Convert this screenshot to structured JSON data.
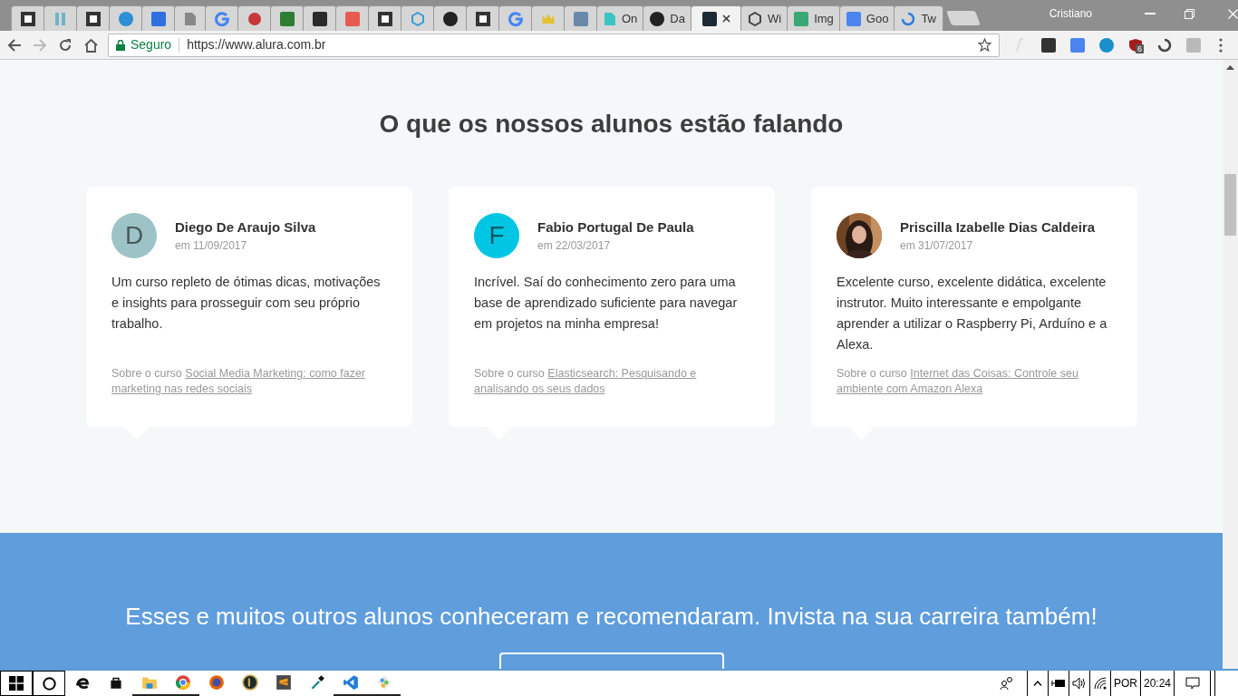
{
  "browser": {
    "tabs": [
      {
        "kind": "mono",
        "color": "#333333",
        "selected": false
      },
      {
        "kind": "letters",
        "color": "#6fb3c8",
        "selected": false
      },
      {
        "kind": "mono",
        "color": "#333333",
        "selected": false
      },
      {
        "kind": "circle",
        "color": "#2d8fd5",
        "selected": false
      },
      {
        "kind": "square",
        "color": "#2f6fe0",
        "selected": false
      },
      {
        "kind": "page",
        "color": "#888888",
        "selected": false
      },
      {
        "kind": "multi",
        "color": "#4285f4",
        "selected": false
      },
      {
        "kind": "dot",
        "color": "#c8383a",
        "selected": false
      },
      {
        "kind": "square",
        "color": "#2e7d32",
        "selected": false
      },
      {
        "kind": "square",
        "color": "#2b2b2b",
        "selected": false
      },
      {
        "kind": "square",
        "color": "#e85a4f",
        "selected": false
      },
      {
        "kind": "mono",
        "color": "#333333",
        "selected": false
      },
      {
        "kind": "hexagon",
        "color": "#3a9ad9",
        "selected": false
      },
      {
        "kind": "circle",
        "color": "#222222",
        "selected": false
      },
      {
        "kind": "mono",
        "color": "#333333",
        "selected": false
      },
      {
        "kind": "multi",
        "color": "#4285f4",
        "selected": false
      },
      {
        "kind": "crown",
        "color": "#e2c230",
        "selected": false
      },
      {
        "kind": "square",
        "color": "#6a88a8",
        "selected": false
      },
      {
        "kind": "page",
        "color": "#3cc4c4",
        "title": "On",
        "selected": false
      },
      {
        "kind": "circle",
        "color": "#222222",
        "title": "Da",
        "selected": false
      },
      {
        "kind": "square",
        "color": "#1c2b33",
        "selected": true
      },
      {
        "kind": "hexagon",
        "color": "#444444",
        "title": "Wi",
        "selected": false
      },
      {
        "kind": "square",
        "color": "#3aa876",
        "title": "Img",
        "selected": false
      },
      {
        "kind": "square",
        "color": "#4a85f0",
        "title": "Goo",
        "selected": false
      },
      {
        "kind": "ring",
        "color": "#2f7de1",
        "title": "Tw",
        "selected": false
      }
    ],
    "user": "Cristiano",
    "security": "Seguro",
    "url": "https://www.alura.com.br",
    "extensions": [
      {
        "kind": "faded",
        "color": "#dddddd"
      },
      {
        "kind": "square",
        "color": "#333333"
      },
      {
        "kind": "square",
        "color": "#4a85f0"
      },
      {
        "kind": "circle",
        "color": "#1a8fc9"
      },
      {
        "kind": "shield",
        "color": "#a51d1d",
        "badge": "6"
      },
      {
        "kind": "ring",
        "color": "#444444"
      },
      {
        "kind": "square",
        "color": "#b9b9b9"
      }
    ]
  },
  "page": {
    "heading": "O que os nossos alunos estão falando",
    "testimonials": [
      {
        "avatar": {
          "kind": "letter",
          "letter": "D",
          "color": "#9dc3c6"
        },
        "name": "Diego De Araujo Silva",
        "date": "em 11/09/2017",
        "text": "Um curso repleto de ótimas dicas, motivações e insights para prosseguir com seu próprio trabalho.",
        "course_prefix": "Sobre o curso",
        "course": "Social Media Marketing: como fazer marketing nas redes sociais"
      },
      {
        "avatar": {
          "kind": "letter",
          "letter": "F",
          "color": "#00c6e3"
        },
        "name": "Fabio Portugal De Paula",
        "date": "em 22/03/2017",
        "text": "Incrível. Saí do conhecimento zero para uma base de aprendizado suficiente para navegar em projetos na minha empresa!",
        "course_prefix": "Sobre o curso",
        "course": "Elasticsearch: Pesquisando e analisando os seus dados"
      },
      {
        "name": "Priscilla Izabelle Dias Caldeira",
        "date": "em 31/07/2017",
        "text": "Excelente curso, excelente didática, excelente instrutor. Muito interessante e empolgante aprender a utilizar o Raspberry Pi, Arduíno e a Alexa.",
        "course_prefix": "Sobre o curso",
        "course": "Internet das Coisas: Controle seu ambiente com Amazon Alexa"
      }
    ],
    "cta_text": "Esses e muitos outros alunos conheceram e recomendaram. Invista na sua carreira também!"
  },
  "taskbar": {
    "apps": [
      {
        "kind": "edge",
        "running": false
      },
      {
        "kind": "store",
        "running": false
      },
      {
        "kind": "folder",
        "running": true
      },
      {
        "kind": "chrome",
        "running": true
      },
      {
        "kind": "firefox",
        "running": false
      },
      {
        "kind": "game",
        "running": false
      },
      {
        "kind": "sublime",
        "running": false
      },
      {
        "kind": "dropper",
        "running": false
      },
      {
        "kind": "code",
        "running": true
      },
      {
        "kind": "paint",
        "running": true
      }
    ],
    "language": "POR",
    "time": "20:24"
  }
}
